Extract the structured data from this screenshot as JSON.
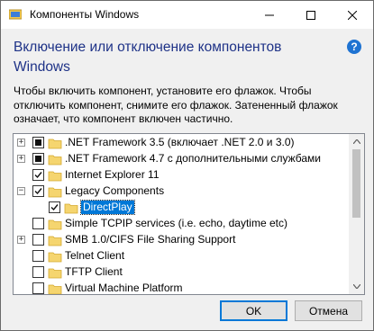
{
  "window": {
    "title": "Компоненты Windows",
    "heading": "Включение или отключение компонентов Windows",
    "help_symbol": "?",
    "description": "Чтобы включить компонент, установите его флажок. Чтобы отключить компонент, снимите его флажок. Затененный флажок означает, что компонент включен частично."
  },
  "title_buttons": {
    "minimize": "minimize-icon",
    "maximize": "maximize-icon",
    "close": "close-icon"
  },
  "features": [
    {
      "label": ".NET Framework 3.5 (включает .NET 2.0 и 3.0)",
      "state": "partial",
      "expander": "+"
    },
    {
      "label": ".NET Framework 4.7 с дополнительными службами",
      "state": "partial",
      "expander": "+"
    },
    {
      "label": "Internet Explorer 11",
      "state": "checked",
      "expander": ""
    },
    {
      "label": "Legacy Components",
      "state": "checked",
      "expander": "−"
    },
    {
      "label": "DirectPlay",
      "state": "checked",
      "expander": "",
      "selected": true
    },
    {
      "label": "Simple TCPIP services (i.e. echo, daytime etc)",
      "state": "unchecked",
      "expander": ""
    },
    {
      "label": "SMB 1.0/CIFS File Sharing Support",
      "state": "unchecked",
      "expander": "+"
    },
    {
      "label": "Telnet Client",
      "state": "unchecked",
      "expander": ""
    },
    {
      "label": "TFTP Client",
      "state": "unchecked",
      "expander": ""
    },
    {
      "label": "Virtual Machine Platform",
      "state": "unchecked",
      "expander": ""
    }
  ],
  "buttons": {
    "ok": "OK",
    "cancel": "Отмена"
  },
  "colors": {
    "heading": "#1e3287",
    "selection": "#0078d7",
    "folder": "#f5d56f"
  }
}
